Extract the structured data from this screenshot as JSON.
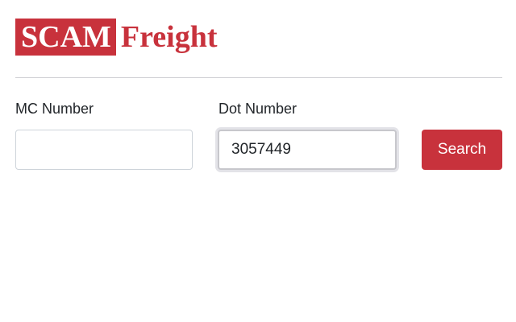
{
  "logo": {
    "boxed_text": "SCAM",
    "word_text": "Freight"
  },
  "form": {
    "mc_label": "MC Number",
    "mc_value": "",
    "dot_label": "Dot Number",
    "dot_value": "3057449",
    "search_label": "Search"
  },
  "colors": {
    "brand_red": "#c8323c",
    "divider": "#cfcfd3",
    "text": "#212529"
  }
}
